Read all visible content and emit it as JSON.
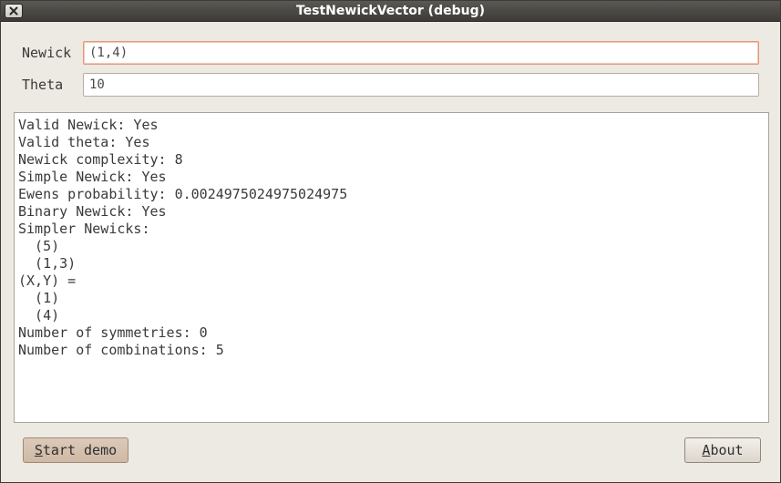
{
  "window": {
    "title": "TestNewickVector (debug)"
  },
  "form": {
    "newick_label": "Newick",
    "newick_value": "(1,4)",
    "theta_label": "Theta",
    "theta_value": "10"
  },
  "output": {
    "lines": [
      "Valid Newick: Yes",
      "Valid theta: Yes",
      "Newick complexity: 8",
      "Simple Newick: Yes",
      "Ewens probability: 0.0024975024975024975",
      "Binary Newick: Yes",
      "Simpler Newicks:",
      "  (5)",
      "  (1,3)",
      "(X,Y) =",
      "  (1)",
      "  (4)",
      "Number of symmetries: 0",
      "Number of combinations: 5"
    ]
  },
  "buttons": {
    "start_demo_mnemonic": "S",
    "start_demo_rest": "tart demo",
    "about_mnemonic": "A",
    "about_rest": "bout"
  },
  "icons": {
    "close": "close-icon"
  },
  "colors": {
    "titlebar": "#3c3b37",
    "window_bg": "#ede9e3",
    "focus_border": "#e09a7a",
    "start_button": "#d6c2b0"
  }
}
